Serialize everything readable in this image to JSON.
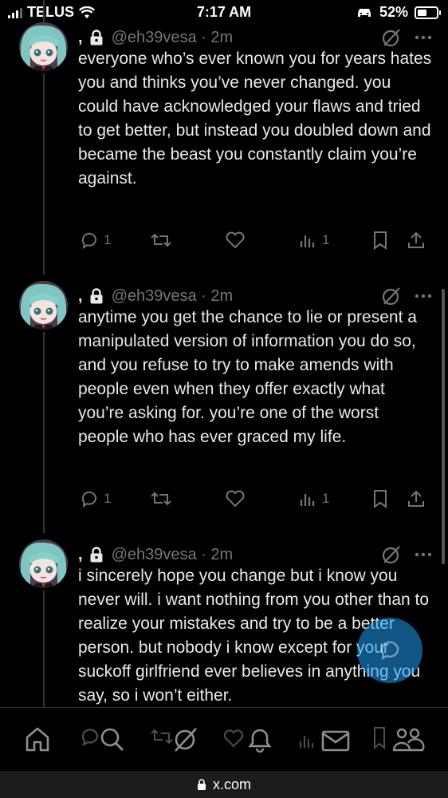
{
  "status_bar": {
    "carrier": "TELUS",
    "time": "7:17 AM",
    "battery": "52%",
    "battery_level": 0.52
  },
  "tweets": [
    {
      "name": ",",
      "handle": "@eh39vesa · 2m",
      "text": "everyone who’s ever known you for years hates you and thinks you’ve never changed. you could have acknowledged your flaws and tried to get better, but instead you doubled down and became the beast you constantly claim you’re against.",
      "replies": "1",
      "views": "1"
    },
    {
      "name": ",",
      "handle": "@eh39vesa · 2m",
      "text": "anytime you get the chance to lie or present a manipulated version of information you do so, and you refuse to try to make amends with people even when they offer exactly what you’re asking for. you’re one of the worst people who has ever graced my life.",
      "replies": "1",
      "views": "1"
    },
    {
      "name": ",",
      "handle": "@eh39vesa · 2m",
      "text": "i sincerely hope you change but i know you never will. i want nothing from you other than to realize your mistakes and try to be a better person. but nobody i know except for your suckoff girlfriend ever believes in anything you say, so i won’t either."
    }
  ],
  "url": "x.com",
  "colors": {
    "background": "#000000",
    "text": "#e7e9ea",
    "muted": "#71767b",
    "accent": "#1d9bf0"
  },
  "icons": [
    "lock-icon",
    "grok-icon",
    "more-icon",
    "reply-icon",
    "retweet-icon",
    "like-icon",
    "views-icon",
    "bookmark-icon",
    "share-icon",
    "home-icon",
    "search-icon",
    "notifications-icon",
    "messages-icon",
    "communities-icon"
  ]
}
